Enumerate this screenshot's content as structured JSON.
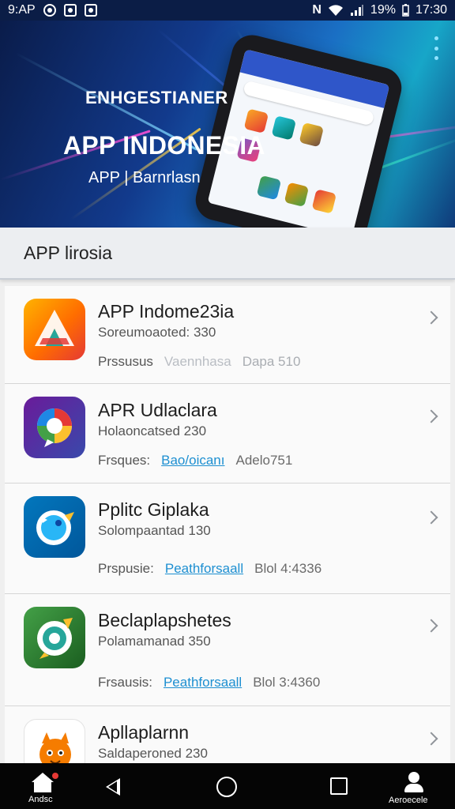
{
  "status_bar": {
    "left_text": "9:AP",
    "battery_text": "19%",
    "time": "17:30",
    "icons": [
      "target-icon",
      "camera-icon",
      "image-icon",
      "nfc-icon",
      "wifi-icon",
      "signal-icon",
      "battery-icon"
    ]
  },
  "banner": {
    "kicker": "ENHGESTIANER",
    "title": "APP INDONESIA",
    "subtitle": "APP | Barnrlasn",
    "menu_icon": "more-vert-icon"
  },
  "section": {
    "title": "APP lirosia"
  },
  "apps": [
    {
      "name": "APP Indome23ia",
      "sub": "Soreumoaoted: 330",
      "meta_label": "Prssusus",
      "meta_link": "Vaennhasa",
      "meta_value": "Dapa 510",
      "faded": true,
      "icon": "abstract-triangle-icon"
    },
    {
      "name": "APR Udlaclara",
      "sub": "Holaoncatsed 230",
      "meta_label": "Frsques:",
      "meta_link": "Bao/oicanı",
      "meta_value": "Adelo751",
      "faded": false,
      "icon": "color-bubble-icon"
    },
    {
      "name": "Pplitc Giplaka",
      "sub": "Solompaantad 130",
      "meta_label": "Prspusie:",
      "meta_link": "Peathforsaall",
      "meta_value": "Blol 4:4336",
      "faded": false,
      "icon": "bird-icon"
    },
    {
      "name": "Beclaplapshetes",
      "sub": "Polamamanad 350",
      "meta_label": "Frsausis:",
      "meta_link": "Peathforsaall",
      "meta_value": "Blol 3:4360",
      "faded": false,
      "icon": "compass-icon"
    },
    {
      "name": "Apllaplarnn",
      "sub": "Saldaperoned 230",
      "meta_label": "",
      "meta_link": "",
      "meta_value": "",
      "faded": false,
      "icon": "cartoon-fox-icon"
    }
  ],
  "bottom_nav": {
    "home_label": "Andsc",
    "profile_label": "Aeroecele"
  },
  "colors": {
    "banner_dark": "#0a1c4a",
    "banner_mid": "#1a6fc4",
    "link": "#1d8fd1",
    "nav_bg": "#050505"
  }
}
